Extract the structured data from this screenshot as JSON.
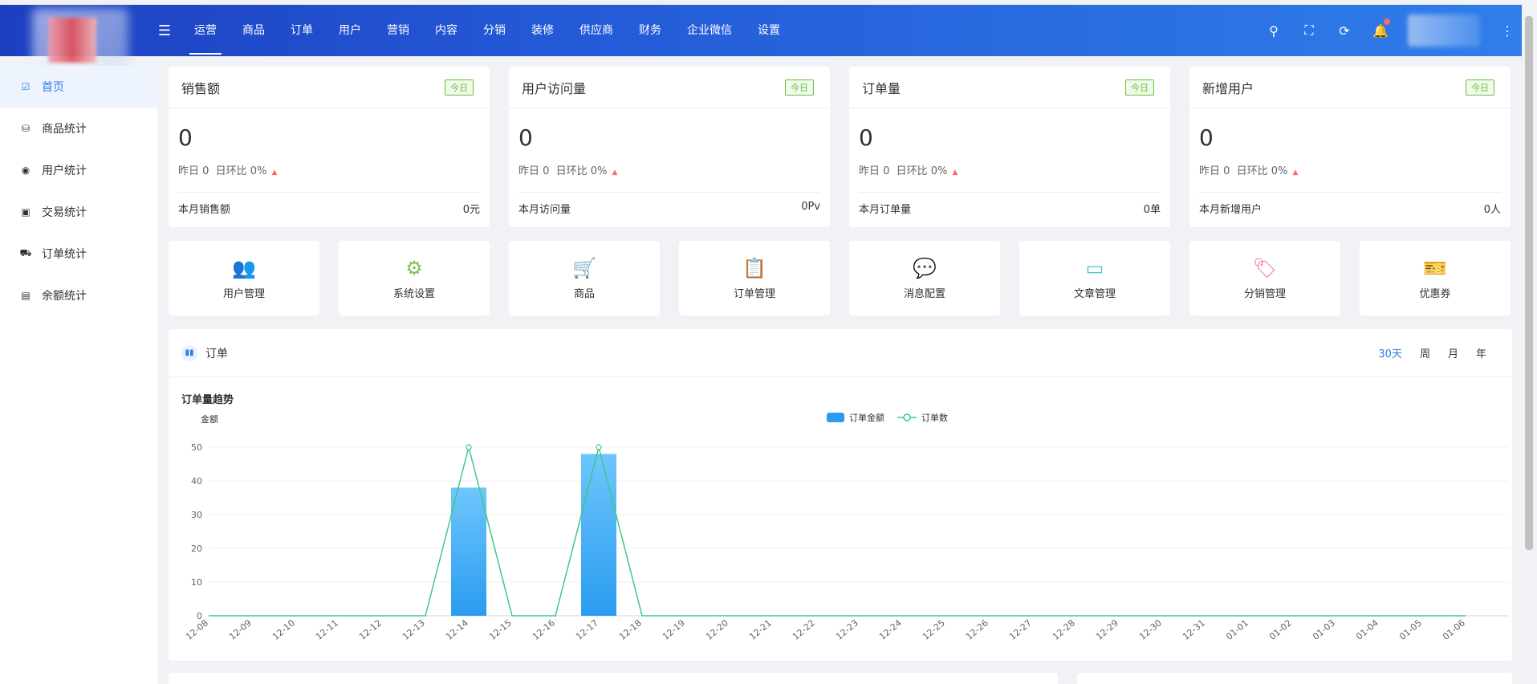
{
  "header": {
    "nav": [
      "运营",
      "商品",
      "订单",
      "用户",
      "营销",
      "内容",
      "分销",
      "装修",
      "供应商",
      "财务",
      "企业微信",
      "设置"
    ],
    "active_nav": "运营"
  },
  "sidebar": {
    "items": [
      {
        "label": "首页",
        "icon": "chart-check-icon"
      },
      {
        "label": "商品统计",
        "icon": "basket-icon"
      },
      {
        "label": "用户统计",
        "icon": "user-circle-icon"
      },
      {
        "label": "交易统计",
        "icon": "money-icon"
      },
      {
        "label": "订单统计",
        "icon": "cart-icon"
      },
      {
        "label": "余额统计",
        "icon": "wallet-icon"
      }
    ]
  },
  "stats": [
    {
      "title": "销售额",
      "tag": "今日",
      "value": "0",
      "yesterday": "昨日 0",
      "ratio": "日环比 0%",
      "foot_label": "本月销售额",
      "foot_value": "0元"
    },
    {
      "title": "用户访问量",
      "tag": "今日",
      "value": "0",
      "yesterday": "昨日 0",
      "ratio": "日环比 0%",
      "foot_label": "本月访问量",
      "foot_value": "0Pv"
    },
    {
      "title": "订单量",
      "tag": "今日",
      "value": "0",
      "yesterday": "昨日 0",
      "ratio": "日环比 0%",
      "foot_label": "本月订单量",
      "foot_value": "0单"
    },
    {
      "title": "新增用户",
      "tag": "今日",
      "value": "0",
      "yesterday": "昨日 0",
      "ratio": "日环比 0%",
      "foot_label": "本月新增用户",
      "foot_value": "0人"
    }
  ],
  "quick_nav": [
    {
      "label": "用户管理",
      "icon": "users-icon",
      "color": "#4aa3f0"
    },
    {
      "label": "系统设置",
      "icon": "gear-icon",
      "color": "#7ec050"
    },
    {
      "label": "商品",
      "icon": "cart-icon",
      "color": "#f08a4b"
    },
    {
      "label": "订单管理",
      "icon": "clipboard-icon",
      "color": "#a16be0"
    },
    {
      "label": "消息配置",
      "icon": "chat-icon",
      "color": "#f5c33b"
    },
    {
      "label": "文章管理",
      "icon": "card-icon",
      "color": "#3fc9c0"
    },
    {
      "label": "分销管理",
      "icon": "tag-icon",
      "color": "#f06fa0"
    },
    {
      "label": "优惠券",
      "icon": "coupon-icon",
      "color": "#f5a94a"
    }
  ],
  "order_panel": {
    "title": "订单",
    "ranges": [
      "30天",
      "周",
      "月",
      "年"
    ],
    "active_range": "30天"
  },
  "chart_data": {
    "type": "bar",
    "title": "订单量趋势",
    "ylabel": "金额",
    "ylim": [
      0,
      50
    ],
    "yticks": [
      0,
      10,
      20,
      30,
      40,
      50
    ],
    "categories": [
      "12-08",
      "12-09",
      "12-10",
      "12-11",
      "12-12",
      "12-13",
      "12-14",
      "12-15",
      "12-16",
      "12-17",
      "12-18",
      "12-19",
      "12-20",
      "12-21",
      "12-22",
      "12-23",
      "12-24",
      "12-25",
      "12-26",
      "12-27",
      "12-28",
      "12-29",
      "12-30",
      "12-31",
      "01-01",
      "01-02",
      "01-03",
      "01-04",
      "01-05",
      "01-06"
    ],
    "series": [
      {
        "name": "订单金额",
        "type": "bar",
        "color": "#2a9cf0",
        "values": [
          0,
          0,
          0,
          0,
          0,
          0,
          38,
          0,
          0,
          48,
          0,
          0,
          0,
          0,
          0,
          0,
          0,
          0,
          0,
          0,
          0,
          0,
          0,
          0,
          0,
          0,
          0,
          0,
          0,
          0
        ]
      },
      {
        "name": "订单数",
        "type": "line",
        "color": "#3cc98a",
        "values": [
          0,
          0,
          0,
          0,
          0,
          0,
          50,
          0,
          0,
          50,
          0,
          0,
          0,
          0,
          0,
          0,
          0,
          0,
          0,
          0,
          0,
          0,
          0,
          0,
          0,
          0,
          0,
          0,
          0,
          0
        ]
      }
    ],
    "legend": "top-center"
  }
}
